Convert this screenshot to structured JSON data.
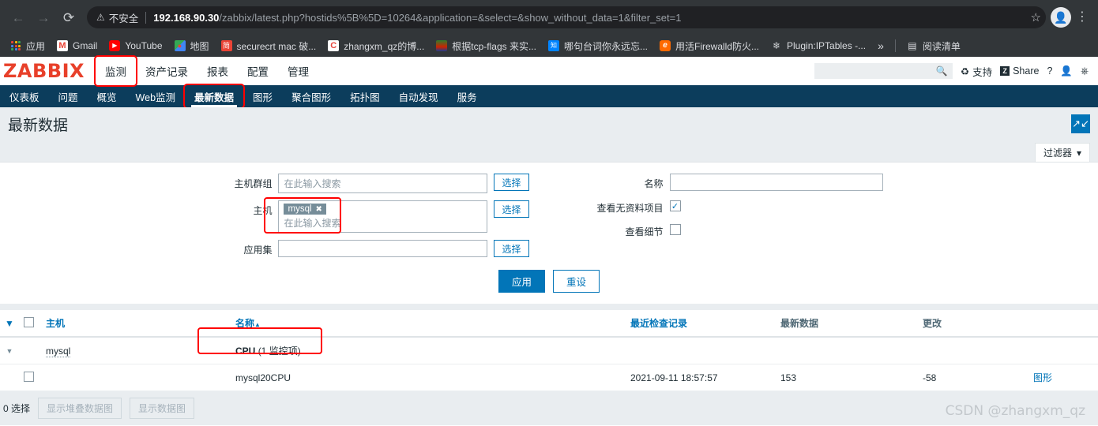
{
  "browser": {
    "nav": {
      "back": "←",
      "forward": "→",
      "reload": "⟳"
    },
    "security_label": "不安全",
    "url_host": "192.168.90.30",
    "url_path": "/zabbix/latest.php?hostids%5B%5D=10264&application=&select=&show_without_data=1&filter_set=1",
    "bookmarks": [
      {
        "label": "应用",
        "icon": "apps-grid-icon"
      },
      {
        "label": "Gmail",
        "icon": "gmail-icon"
      },
      {
        "label": "YouTube",
        "icon": "youtube-icon"
      },
      {
        "label": "地图",
        "icon": "maps-icon"
      },
      {
        "label": "securecrt mac 破...",
        "icon": "jianshu-icon"
      },
      {
        "label": "zhangxm_qz的博...",
        "icon": "csdn-icon"
      },
      {
        "label": "根据tcp-flags 来实...",
        "icon": "image-icon"
      },
      {
        "label": "哪句台词你永远忘...",
        "icon": "zhihu-icon"
      },
      {
        "label": "用活Firewalld防火...",
        "icon": "evernote-icon"
      },
      {
        "label": "Plugin:IPTables -...",
        "icon": "snowflake-icon"
      }
    ],
    "overflow": "»",
    "reading_list": "阅读清单"
  },
  "zabbix": {
    "logo": "ZABBIX",
    "main_nav": [
      {
        "label": "监测",
        "selected": true
      },
      {
        "label": "资产记录",
        "selected": false
      },
      {
        "label": "报表",
        "selected": false
      },
      {
        "label": "配置",
        "selected": false
      },
      {
        "label": "管理",
        "selected": false
      }
    ],
    "header_search_value": "",
    "support_label": "支持",
    "share_label": "Share",
    "share_badge": "Z",
    "help_label": "?",
    "sub_nav": [
      {
        "label": "仪表板",
        "selected": false
      },
      {
        "label": "问题",
        "selected": false
      },
      {
        "label": "概览",
        "selected": false
      },
      {
        "label": "Web监测",
        "selected": false
      },
      {
        "label": "最新数据",
        "selected": true
      },
      {
        "label": "图形",
        "selected": false
      },
      {
        "label": "聚合图形",
        "selected": false
      },
      {
        "label": "拓扑图",
        "selected": false
      },
      {
        "label": "自动发现",
        "selected": false
      },
      {
        "label": "服务",
        "selected": false
      }
    ],
    "page_title": "最新数据",
    "filter_tab_label": "过滤器"
  },
  "filter": {
    "host_group": {
      "label": "主机群组",
      "value": "",
      "placeholder": "在此输入搜索",
      "select_label": "选择"
    },
    "host": {
      "label": "主机",
      "chip": "mysql",
      "chip_remove": "✖",
      "placeholder": "在此输入搜索",
      "select_label": "选择"
    },
    "application": {
      "label": "应用集",
      "value": "",
      "placeholder": "",
      "select_label": "选择"
    },
    "name": {
      "label": "名称",
      "value": "",
      "placeholder": ""
    },
    "show_without_data": {
      "label": "查看无资料项目",
      "checked": true,
      "mark": "✓"
    },
    "show_details": {
      "label": "查看细节",
      "checked": false,
      "mark": ""
    },
    "apply_label": "应用",
    "reset_label": "重设"
  },
  "table": {
    "headers": {
      "host": "主机",
      "name": "名称",
      "name_sort": "▲",
      "last_check": "最近检查记录",
      "last_value": "最新数据",
      "change": "更改",
      "action": ""
    },
    "group_row": {
      "host": "mysql",
      "application": "CPU",
      "application_suffix": "(1 监控项)"
    },
    "item_row": {
      "name": "mysql20CPU",
      "last_check": "2021-09-11 18:57:57",
      "last_value": "153",
      "change": "-58",
      "graph_link": "图形"
    }
  },
  "footer": {
    "selected_count": "0 选择",
    "stacked_graph_label": "显示堆叠数据图",
    "graph_label": "显示数据图"
  },
  "watermark": "CSDN @zhangxm_qz"
}
